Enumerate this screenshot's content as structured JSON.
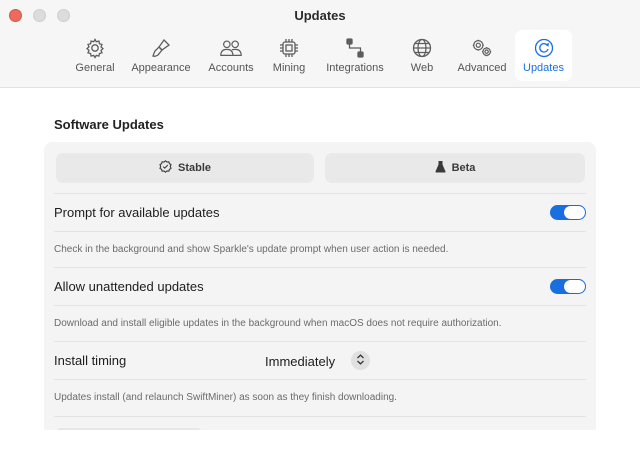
{
  "window": {
    "title": "Updates"
  },
  "tabs": [
    {
      "label": "General",
      "icon": "gear-icon"
    },
    {
      "label": "Appearance",
      "icon": "paintbrush-icon"
    },
    {
      "label": "Accounts",
      "icon": "people-icon"
    },
    {
      "label": "Mining",
      "icon": "cpu-chip-icon"
    },
    {
      "label": "Integrations",
      "icon": "integrations-icon"
    },
    {
      "label": "Web",
      "icon": "globe-icon"
    },
    {
      "label": "Advanced",
      "icon": "gears-icon"
    },
    {
      "label": "Updates",
      "icon": "refresh-icon",
      "active": true
    }
  ],
  "software_updates": {
    "title": "Software Updates",
    "channels": [
      {
        "label": "Stable",
        "icon": "check-seal-icon"
      },
      {
        "label": "Beta",
        "icon": "flask-icon"
      }
    ],
    "rows": [
      {
        "label": "Prompt for available updates",
        "enabled": true,
        "description": "Check in the background and show Sparkle's update prompt when user action is needed."
      },
      {
        "label": "Allow unattended updates",
        "enabled": true,
        "description": "Download and install eligible updates in the background when macOS does not require authorization."
      }
    ],
    "install_timing": {
      "label": "Install timing",
      "value": "Immediately",
      "description": "Updates install (and relaunch SwiftMiner) as soon as they finish downloading."
    }
  },
  "colors": {
    "accent": "#1a6fe0",
    "close": "#ed6a5e"
  }
}
